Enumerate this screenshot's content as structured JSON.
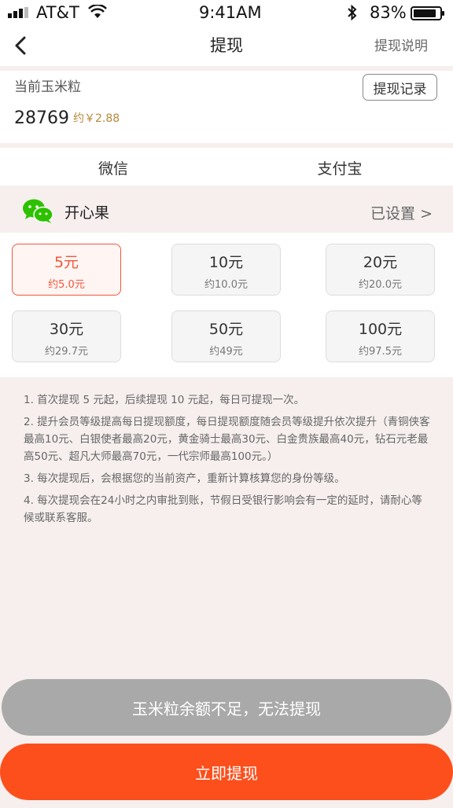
{
  "status": {
    "carrier": "AT&T",
    "time": "9:41AM",
    "battery": "83%"
  },
  "nav": {
    "title": "提现",
    "help": "提现说明"
  },
  "balance": {
    "label": "当前玉米粒",
    "value": "28769",
    "approx": "约￥2.88",
    "records_button": "提现记录"
  },
  "tabs": [
    {
      "label": "微信"
    },
    {
      "label": "支付宝"
    }
  ],
  "account": {
    "name": "开心果",
    "status": "已设置 >"
  },
  "amounts": [
    {
      "label": "5元",
      "sub": "约5.0元",
      "selected": true
    },
    {
      "label": "10元",
      "sub": "约10.0元"
    },
    {
      "label": "20元",
      "sub": "约20.0元"
    },
    {
      "label": "30元",
      "sub": "约29.7元"
    },
    {
      "label": "50元",
      "sub": "约49元"
    },
    {
      "label": "100元",
      "sub": "约97.5元"
    }
  ],
  "notes": [
    "1. 首次提现 5 元起，后续提现 10 元起，每日可提现一次。",
    "2. 提升会员等级提高每日提现额度，每日提现额度随会员等级提升依次提升（青铜侠客最高10元、白银使者最高20元，黄金骑士最高30元、白金贵族最高40元，钻石元老最高50元、超凡大师最高70元，一代宗师最高100元。）",
    "3. 每次提现后，会根据您的当前资产，重新计算核算您的身份等级。",
    "4. 每次提现会在24小时之内审批到账，节假日受银行影响会有一定的延时，请耐心等候或联系客服。"
  ],
  "buttons": {
    "insufficient": "玉米粒余额不足，无法提现",
    "withdraw": "立即提现"
  },
  "colors": {
    "accent": "#fc4f1c",
    "selected_border": "#f0573c",
    "wechat": "#2dc100"
  }
}
